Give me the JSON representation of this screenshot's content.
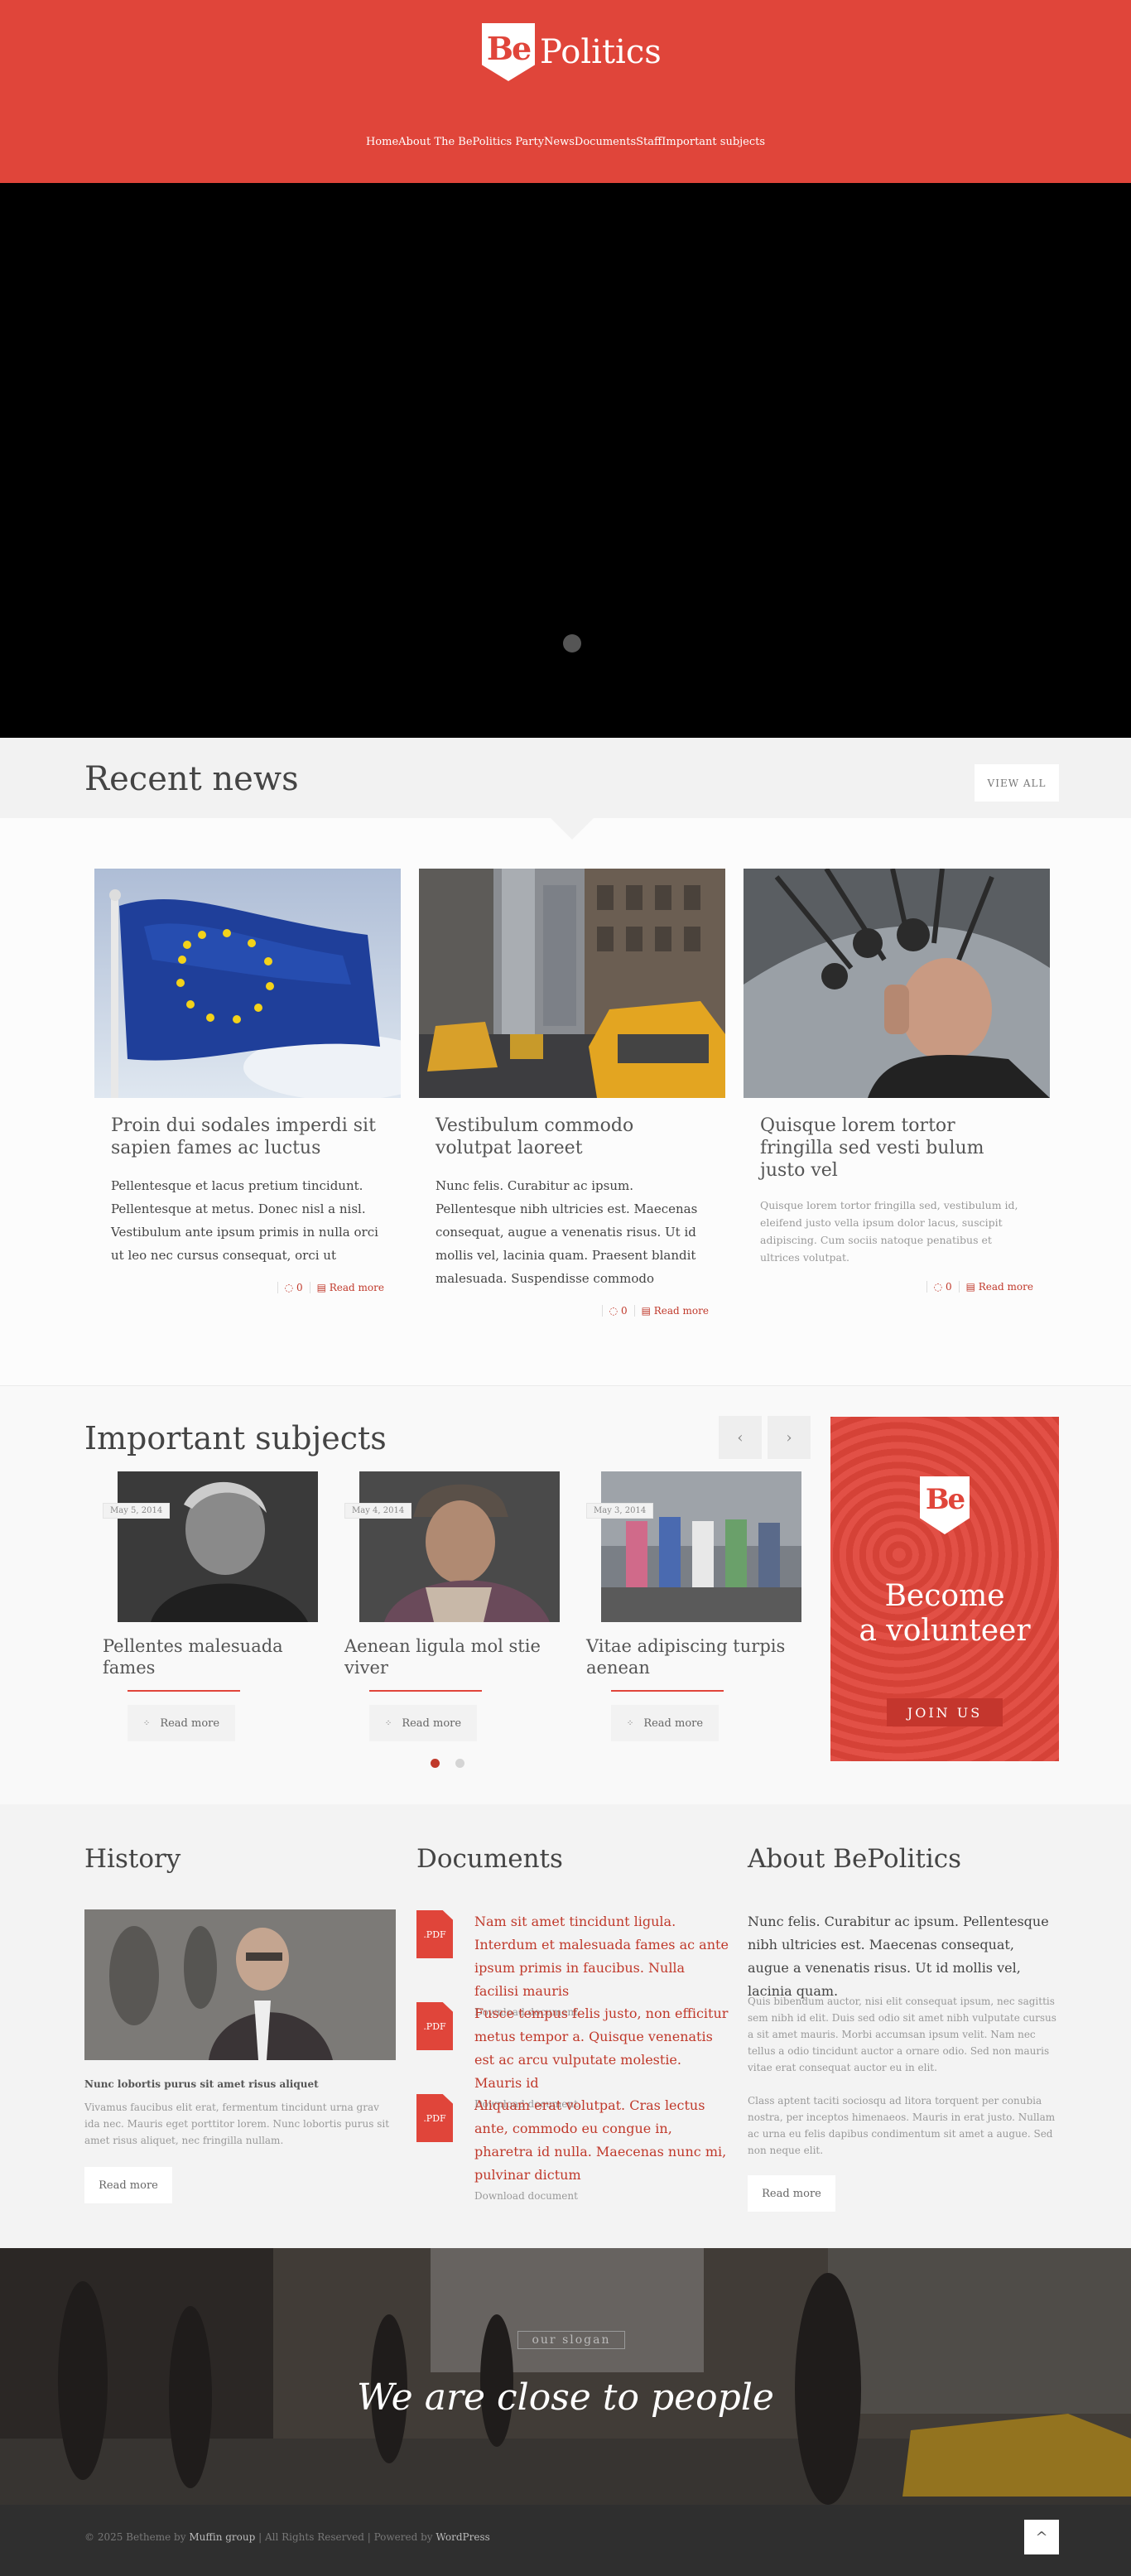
{
  "header": {
    "logo_mark": "Be",
    "logo_text": "Politics",
    "nav": [
      "Home",
      "About The BePolitics Party",
      "News",
      "Documents",
      "Staff",
      "Important subjects"
    ]
  },
  "recent_news": {
    "title": "Recent news",
    "view_all": "VIEW ALL",
    "posts": [
      {
        "title": "Proin dui sodales imperdi sit sapien fames ac luctus",
        "excerpt": "Pellentesque et lacus pretium tincidunt. Pellentesque at metus. Donec nisl a nisl. Vestibulum ante ipsum primis in nulla orci ut leo nec cursus consequat, orci ut",
        "comments": "0",
        "read_more": "Read more"
      },
      {
        "title": "Vestibulum commodo volutpat laoreet",
        "excerpt": "Nunc felis. Curabitur ac ipsum. Pellentesque nibh ultricies est. Maecenas consequat, augue a venenatis risus. Ut id mollis vel, lacinia quam. Praesent blandit malesuada. Suspendisse commodo",
        "comments": "0",
        "read_more": "Read more"
      },
      {
        "title": "Quisque lorem tortor fringilla sed vesti bulum justo vel",
        "excerpt": "Quisque lorem tortor fringilla sed, vestibulum id, eleifend justo vella ipsum dolor lacus, suscipit adipiscing. Cum sociis natoque penatibus et ultrices volutpat.",
        "comments": "0",
        "read_more": "Read more"
      }
    ]
  },
  "important": {
    "title": "Important subjects",
    "items": [
      {
        "date": "May 5, 2014",
        "title": "Pellentes malesuada fames",
        "read_more": "Read more"
      },
      {
        "date": "May 4, 2014",
        "title": "Aenean ligula mol stie viver",
        "read_more": "Read more"
      },
      {
        "date": "May 3, 2014",
        "title": "Vitae adipiscing turpis aenean",
        "read_more": "Read more"
      }
    ],
    "volunteer": {
      "mark": "Be",
      "line1": "Become",
      "line2": "a volunteer",
      "button": "JOIN US"
    }
  },
  "history": {
    "title": "History",
    "caption": "Nunc lobortis purus sit amet risus aliquet",
    "text": "Vivamus faucibus elit erat, fermentum tincidunt urna grav ida nec. Mauris eget porttitor lorem. Nunc lobortis purus sit amet risus aliquet, nec fringilla nullam.",
    "button": "Read more"
  },
  "documents": {
    "title": "Documents",
    "badge": ".PDF",
    "items": [
      {
        "title": "Nam sit amet tincidunt ligula. Interdum et malesuada fames ac ante ipsum primis in faucibus. Nulla facilisi mauris",
        "link": "Download document"
      },
      {
        "title": "Fusce tempus felis justo, non efficitur metus tempor a. Quisque venenatis est ac arcu vulputate molestie. Mauris id",
        "link": "Download document"
      },
      {
        "title": "Aliquam erat volutpat. Cras lectus ante, commodo eu congue in, pharetra id nulla. Maecenas nunc mi, pulvinar dictum",
        "link": "Download document"
      }
    ]
  },
  "about": {
    "title": "About BePolitics",
    "lead": "Nunc felis. Curabitur ac ipsum. Pellentesque nibh ultricies est. Maecenas consequat, augue a venenatis risus. Ut id mollis vel, lacinia quam.",
    "p1": "Quis bibendum auctor, nisi elit consequat ipsum, nec sagittis sem nibh id elit. Duis sed odio sit amet nibh vulputate cursus a sit amet mauris. Morbi accumsan ipsum velit. Nam nec tellus a odio tincidunt auctor a ornare odio. Sed non mauris vitae erat consequat auctor eu in elit.",
    "p2": "Class aptent taciti sociosqu ad litora torquent per conubia nostra, per inceptos himenaeos. Mauris in erat justo. Nullam ac urna eu felis dapibus condimentum sit amet a augue. Sed non neque elit.",
    "button": "Read more"
  },
  "slogan": {
    "small": "our slogan",
    "big": "We are close to people"
  },
  "footer": {
    "prefix": "© 2025 Betheme by ",
    "author": "Muffin group",
    "middle": " | All Rights Reserved | Powered by ",
    "powered": "WordPress",
    "to_top": "^"
  },
  "colors": {
    "brand": "#e0453a",
    "dark": "#2f2f2f"
  }
}
